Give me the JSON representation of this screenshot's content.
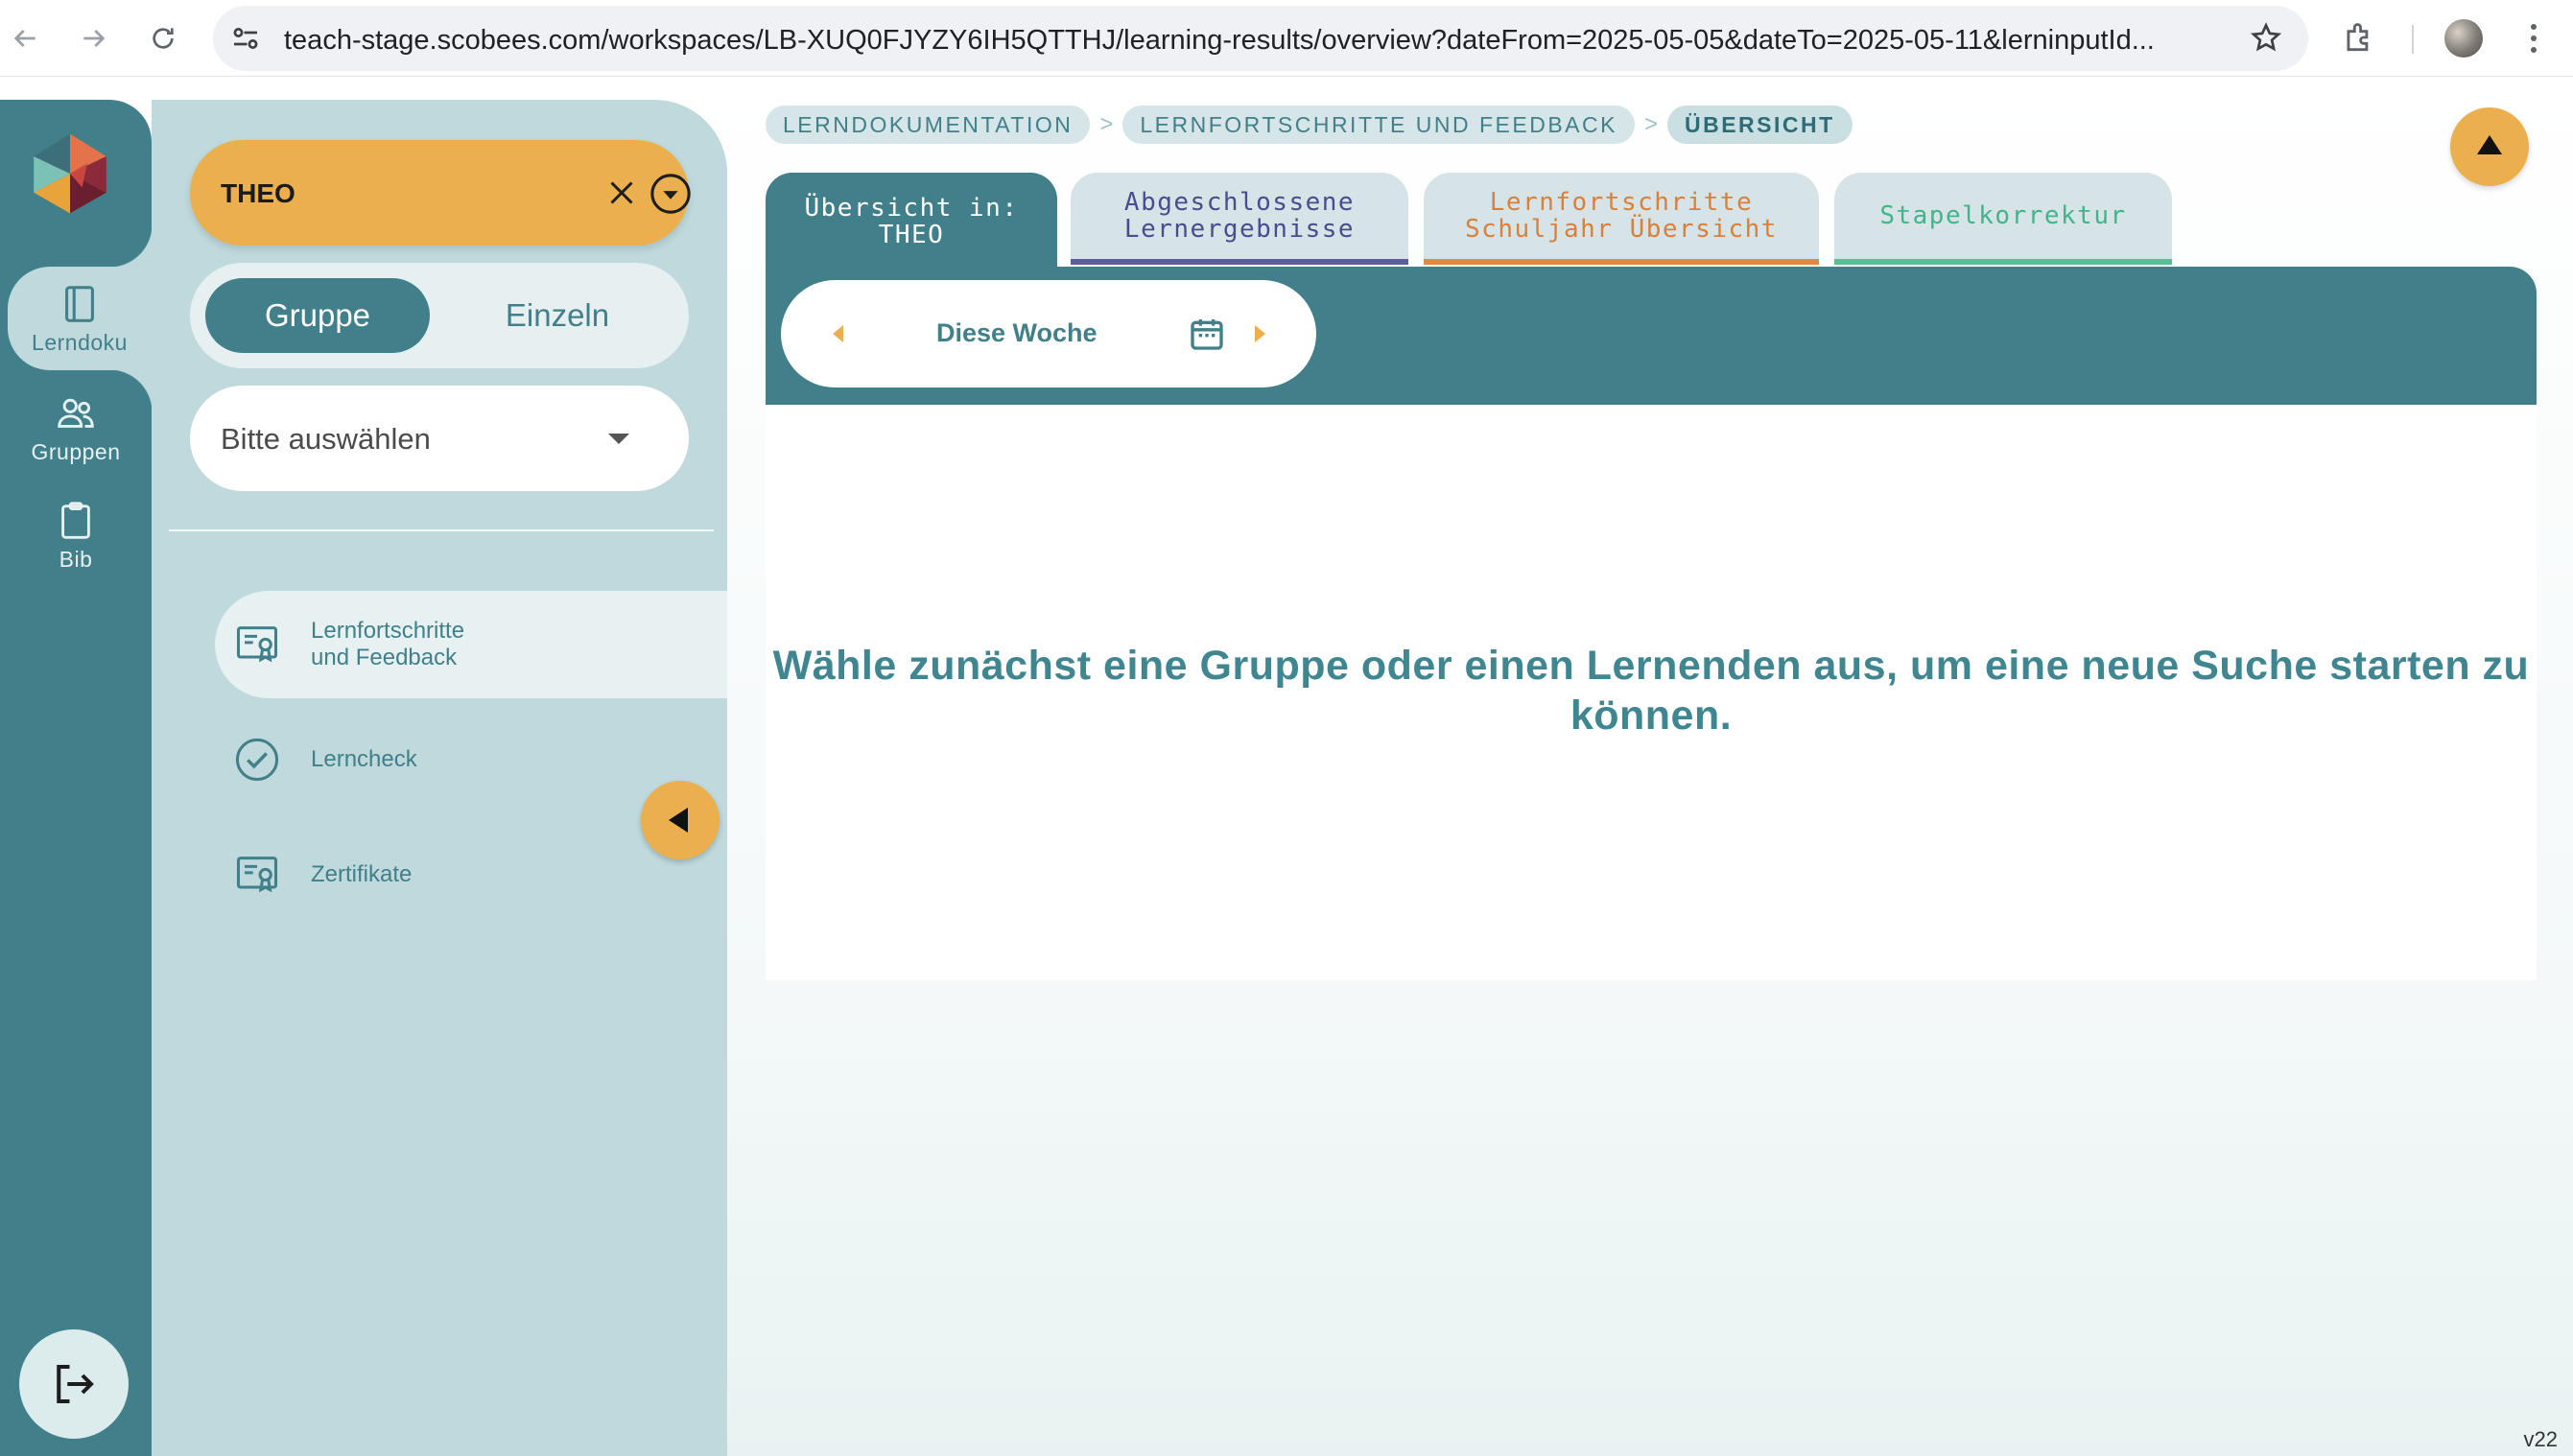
{
  "browser": {
    "url": "teach-stage.scobees.com/workspaces/LB-XUQ0FJYZY6IH5QTTHJ/learning-results/overview?dateFrom=2025-05-05&dateTo=2025-05-11&lerninputId..."
  },
  "rail": {
    "items": [
      {
        "label": "Lerndoku",
        "icon": "notebook-icon"
      },
      {
        "label": "Gruppen",
        "icon": "users-icon"
      },
      {
        "label": "Bib",
        "icon": "clipboard-icon"
      }
    ],
    "logout_icon": "logout-icon"
  },
  "panel": {
    "student": "THEO",
    "toggle": {
      "group": "Gruppe",
      "single": "Einzeln",
      "selected": "Gruppe"
    },
    "select_placeholder": "Bitte auswählen",
    "menu": [
      {
        "line1": "Lernfortschritte",
        "line2": "und Feedback",
        "icon": "certificate-icon",
        "active": true
      },
      {
        "line1": "Lerncheck",
        "line2": "",
        "icon": "check-circle-icon",
        "active": false
      },
      {
        "line1": "Zertifikate",
        "line2": "",
        "icon": "certificate-icon",
        "active": false
      }
    ]
  },
  "breadcrumb": [
    "LERNDOKUMENTATION",
    "LERNFORTSCHRITTE UND FEEDBACK",
    "ÜBERSICHT"
  ],
  "breadcrumb_separator": ">",
  "tabs": [
    {
      "line1": "Übersicht in:",
      "line2": "THEO"
    },
    {
      "line1": "Abgeschlossene",
      "line2": "Lernergebnisse"
    },
    {
      "line1": "Lernfortschritte",
      "line2": "Schuljahr Übersicht"
    },
    {
      "line1": "Stapelkorrektur",
      "line2": ""
    }
  ],
  "week": {
    "label": "Diese Woche"
  },
  "empty_message": "Wähle zunächst eine Gruppe oder einen Lernenden aus, um eine neue Suche starten zu können.",
  "version": "v22",
  "colors": {
    "teal": "#417f8a",
    "panel": "#bfd9dc",
    "accent": "#ebb04d",
    "tab_purple": "#5c5ea0",
    "tab_orange": "#e08a3e",
    "tab_green": "#52c194"
  }
}
